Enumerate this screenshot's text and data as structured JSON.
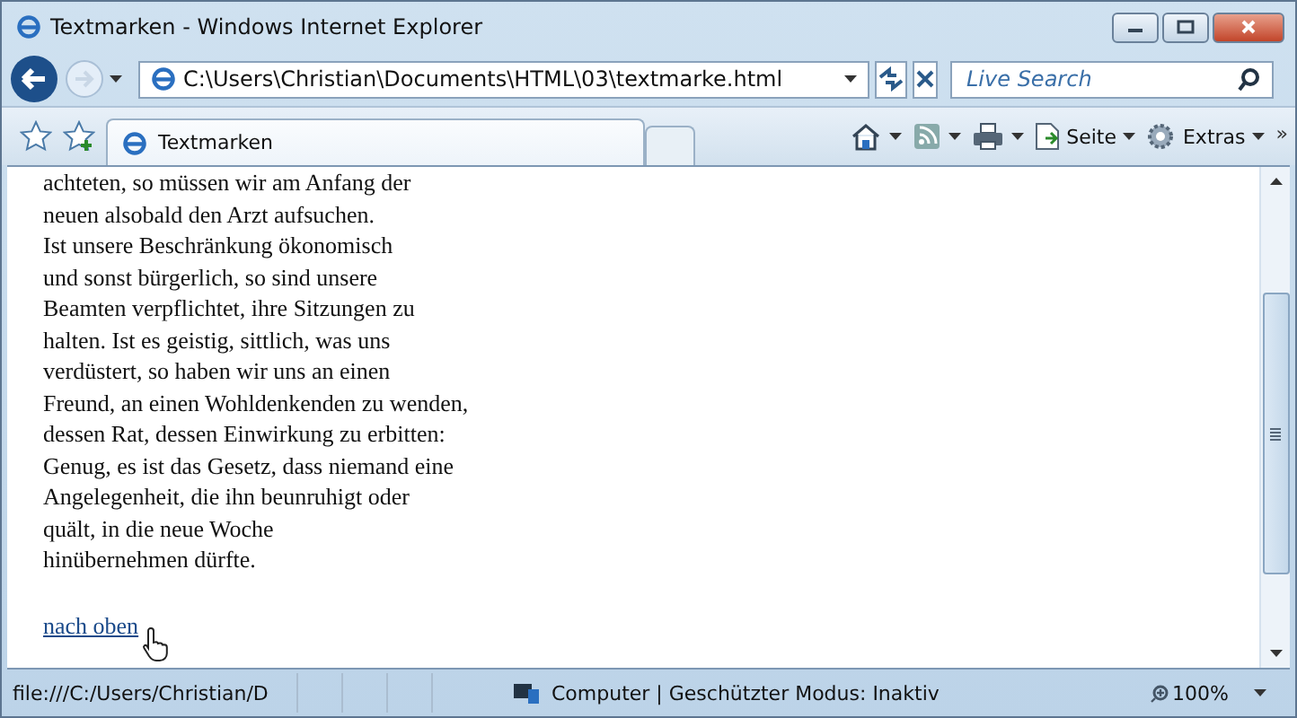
{
  "window": {
    "title": "Textmarken - Windows Internet Explorer"
  },
  "address_bar": {
    "value": "C:\\Users\\Christian\\Documents\\HTML\\03\\textmarke.html"
  },
  "search": {
    "placeholder": "Live Search"
  },
  "tabs": [
    {
      "label": "Textmarken",
      "selected": true
    }
  ],
  "command_bar": [
    {
      "kind": "home"
    },
    {
      "kind": "feeds"
    },
    {
      "kind": "print"
    },
    {
      "kind": "page",
      "label": "Seite"
    },
    {
      "kind": "tools",
      "label": "Extras"
    }
  ],
  "overflow_glyph": "»",
  "page": {
    "lines": [
      "achteten, so müssen wir am Anfang der",
      "neuen alsobald den Arzt aufsuchen.",
      "Ist unsere Beschränkung ökonomisch",
      "und sonst bürgerlich, so sind unsere",
      "Beamten verpflichtet, ihre Sitzungen zu",
      "halten. Ist es geistig, sittlich, was uns",
      "verdüstert, so haben wir uns an einen",
      "Freund, an einen Wohldenkenden zu wenden,",
      "dessen Rat, dessen Einwirkung zu erbitten:",
      "Genug, es ist das Gesetz, dass niemand eine",
      "Angelegenheit, die ihn beunruhigt oder",
      "quält, in die neue Woche",
      "hinübernehmen dürfte."
    ],
    "link": "nach oben"
  },
  "status_bar": {
    "url": "file:///C:/Users/Christian/D",
    "zone": "Computer | Geschützter Modus: Inaktiv",
    "zoom": "100%"
  }
}
